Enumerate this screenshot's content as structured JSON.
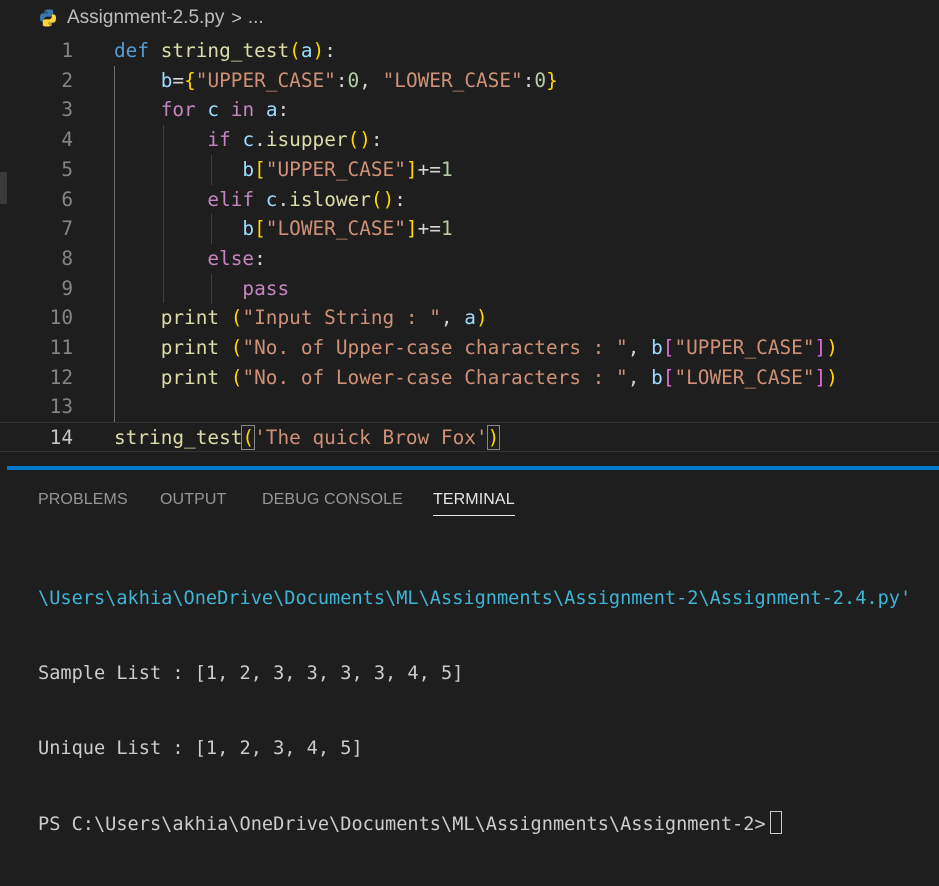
{
  "breadcrumb": {
    "file_name": "Assignment-2.5.py",
    "separator": ">",
    "ellipsis": "..."
  },
  "editor": {
    "current_line": 14,
    "lines": [
      {
        "number": "1",
        "tokens": [
          {
            "t": "def",
            "c": "kw-blue"
          },
          {
            "t": " ",
            "c": "op"
          },
          {
            "t": "string_test",
            "c": "fn"
          },
          {
            "t": "(",
            "c": "br1"
          },
          {
            "t": "a",
            "c": "var"
          },
          {
            "t": ")",
            "c": "br1"
          },
          {
            "t": ":",
            "c": "op"
          }
        ]
      },
      {
        "number": "2",
        "tokens": [
          {
            "t": "    ",
            "c": "op"
          },
          {
            "t": "b",
            "c": "var"
          },
          {
            "t": "=",
            "c": "op"
          },
          {
            "t": "{",
            "c": "br1"
          },
          {
            "t": "\"UPPER_CASE\"",
            "c": "str"
          },
          {
            "t": ":",
            "c": "op"
          },
          {
            "t": "0",
            "c": "num"
          },
          {
            "t": ", ",
            "c": "op"
          },
          {
            "t": "\"LOWER_CASE\"",
            "c": "str"
          },
          {
            "t": ":",
            "c": "op"
          },
          {
            "t": "0",
            "c": "num"
          },
          {
            "t": "}",
            "c": "br1"
          }
        ]
      },
      {
        "number": "3",
        "tokens": [
          {
            "t": "    ",
            "c": "op"
          },
          {
            "t": "for",
            "c": "kw-purple"
          },
          {
            "t": " ",
            "c": "op"
          },
          {
            "t": "c",
            "c": "var"
          },
          {
            "t": " ",
            "c": "op"
          },
          {
            "t": "in",
            "c": "kw-purple"
          },
          {
            "t": " ",
            "c": "op"
          },
          {
            "t": "a",
            "c": "var"
          },
          {
            "t": ":",
            "c": "op"
          }
        ]
      },
      {
        "number": "4",
        "tokens": [
          {
            "t": "        ",
            "c": "op"
          },
          {
            "t": "if",
            "c": "kw-purple"
          },
          {
            "t": " ",
            "c": "op"
          },
          {
            "t": "c",
            "c": "var"
          },
          {
            "t": ".",
            "c": "op"
          },
          {
            "t": "isupper",
            "c": "fn"
          },
          {
            "t": "()",
            "c": "br1"
          },
          {
            "t": ":",
            "c": "op"
          }
        ]
      },
      {
        "number": "5",
        "tokens": [
          {
            "t": "           ",
            "c": "op"
          },
          {
            "t": "b",
            "c": "var"
          },
          {
            "t": "[",
            "c": "br1"
          },
          {
            "t": "\"UPPER_CASE\"",
            "c": "str"
          },
          {
            "t": "]",
            "c": "br1"
          },
          {
            "t": "+=",
            "c": "op"
          },
          {
            "t": "1",
            "c": "num"
          }
        ]
      },
      {
        "number": "6",
        "tokens": [
          {
            "t": "        ",
            "c": "op"
          },
          {
            "t": "elif",
            "c": "kw-purple"
          },
          {
            "t": " ",
            "c": "op"
          },
          {
            "t": "c",
            "c": "var"
          },
          {
            "t": ".",
            "c": "op"
          },
          {
            "t": "islower",
            "c": "fn"
          },
          {
            "t": "()",
            "c": "br1"
          },
          {
            "t": ":",
            "c": "op"
          }
        ]
      },
      {
        "number": "7",
        "tokens": [
          {
            "t": "           ",
            "c": "op"
          },
          {
            "t": "b",
            "c": "var"
          },
          {
            "t": "[",
            "c": "br1"
          },
          {
            "t": "\"LOWER_CASE\"",
            "c": "str"
          },
          {
            "t": "]",
            "c": "br1"
          },
          {
            "t": "+=",
            "c": "op"
          },
          {
            "t": "1",
            "c": "num"
          }
        ]
      },
      {
        "number": "8",
        "tokens": [
          {
            "t": "        ",
            "c": "op"
          },
          {
            "t": "else",
            "c": "kw-purple"
          },
          {
            "t": ":",
            "c": "op"
          }
        ]
      },
      {
        "number": "9",
        "tokens": [
          {
            "t": "           ",
            "c": "op"
          },
          {
            "t": "pass",
            "c": "kw-purple"
          }
        ]
      },
      {
        "number": "10",
        "tokens": [
          {
            "t": "    ",
            "c": "op"
          },
          {
            "t": "print",
            "c": "fn"
          },
          {
            "t": " ",
            "c": "op"
          },
          {
            "t": "(",
            "c": "br1"
          },
          {
            "t": "\"Input String : \"",
            "c": "str"
          },
          {
            "t": ", ",
            "c": "op"
          },
          {
            "t": "a",
            "c": "var"
          },
          {
            "t": ")",
            "c": "br1"
          }
        ]
      },
      {
        "number": "11",
        "tokens": [
          {
            "t": "    ",
            "c": "op"
          },
          {
            "t": "print",
            "c": "fn"
          },
          {
            "t": " ",
            "c": "op"
          },
          {
            "t": "(",
            "c": "br1"
          },
          {
            "t": "\"No. of Upper-case characters : \"",
            "c": "str"
          },
          {
            "t": ", ",
            "c": "op"
          },
          {
            "t": "b",
            "c": "var"
          },
          {
            "t": "[",
            "c": "br2"
          },
          {
            "t": "\"UPPER_CASE\"",
            "c": "str"
          },
          {
            "t": "]",
            "c": "br2"
          },
          {
            "t": ")",
            "c": "br1"
          }
        ]
      },
      {
        "number": "12",
        "tokens": [
          {
            "t": "    ",
            "c": "op"
          },
          {
            "t": "print",
            "c": "fn"
          },
          {
            "t": " ",
            "c": "op"
          },
          {
            "t": "(",
            "c": "br1"
          },
          {
            "t": "\"No. of Lower-case Characters : \"",
            "c": "str"
          },
          {
            "t": ", ",
            "c": "op"
          },
          {
            "t": "b",
            "c": "var"
          },
          {
            "t": "[",
            "c": "br2"
          },
          {
            "t": "\"LOWER_CASE\"",
            "c": "str"
          },
          {
            "t": "]",
            "c": "br2"
          },
          {
            "t": ")",
            "c": "br1"
          }
        ]
      },
      {
        "number": "13",
        "tokens": []
      },
      {
        "number": "14",
        "tokens": [
          {
            "t": "string_test",
            "c": "fn"
          },
          {
            "t": "(",
            "c": "br1 br-match"
          },
          {
            "t": "'The quick Brow Fox'",
            "c": "str"
          },
          {
            "t": ")",
            "c": "br1 br-match"
          }
        ]
      }
    ]
  },
  "panel": {
    "tabs": [
      {
        "label": "PROBLEMS",
        "active": false
      },
      {
        "label": "OUTPUT",
        "active": false
      },
      {
        "label": "DEBUG CONSOLE",
        "active": false
      },
      {
        "label": "TERMINAL",
        "active": true
      }
    ]
  },
  "terminal": {
    "path_line": "\\Users\\akhia\\OneDrive\\Documents\\ML\\Assignments\\Assignment-2\\Assignment-2.4.py'",
    "output_lines": [
      "Sample List : [1, 2, 3, 3, 3, 3, 4, 5]",
      "Unique List : [1, 2, 3, 4, 5]"
    ],
    "prompt": "PS C:\\Users\\akhia\\OneDrive\\Documents\\ML\\Assignments\\Assignment-2>"
  },
  "colors": {
    "accent": "#007acc",
    "background": "#1e1e1e",
    "terminal_path": "#3fb5d6"
  }
}
